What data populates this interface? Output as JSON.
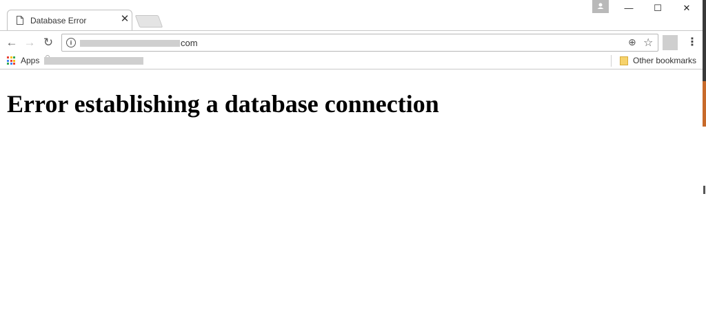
{
  "browser": {
    "tab": {
      "title": "Database Error",
      "close_glyph": "✕"
    },
    "window_controls": {
      "minimize": "—",
      "maximize": "☐",
      "close": "✕"
    },
    "toolbar": {
      "back": "←",
      "forward": "→",
      "reload": "↻",
      "url_visible": "com",
      "info_icon": "i",
      "zoom_icon": "⊕",
      "star_icon": "☆",
      "menu_icon": "⋮"
    },
    "bookmarks": {
      "apps_label": "Apps",
      "other_label": "Other bookmarks"
    }
  },
  "page": {
    "heading": "Error establishing a database connection"
  },
  "colors": {
    "apps_grid": [
      "#e94235",
      "#fbbc04",
      "#34a853",
      "#4285f4",
      "#e94235",
      "#fbbc04",
      "#34a853",
      "#4285f4",
      "#e94235"
    ],
    "folder": "#f6d26b"
  }
}
